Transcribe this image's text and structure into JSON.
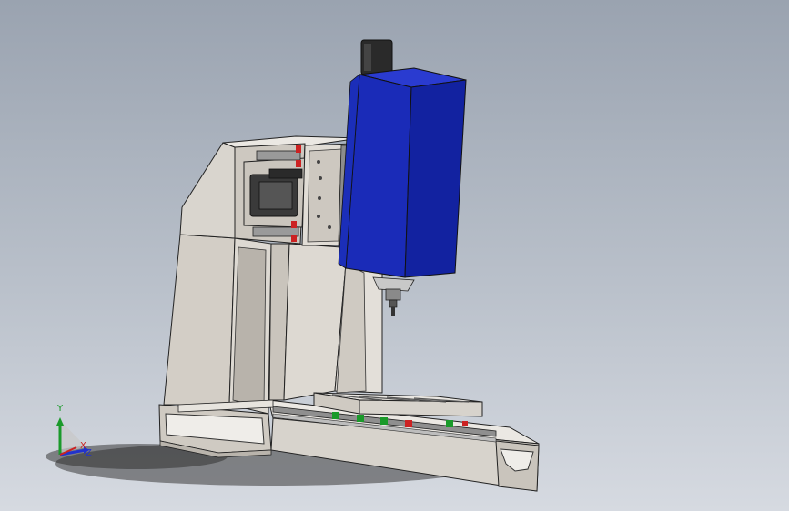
{
  "viewport": {
    "background_top": "#9aa3b0",
    "background_bottom": "#d6dae1"
  },
  "model": {
    "base_color": "#d9d5ce",
    "spindle_color": "#1a2bb8",
    "motor_color": "#2a2a2a",
    "rail_block_colors": [
      "#cc2222",
      "#1a9a2a"
    ]
  },
  "triad": {
    "y_label": "Y",
    "x_label": "X",
    "z_label": "Z",
    "x_color": "#cc2222",
    "y_color": "#1a9a2a",
    "z_color": "#2233cc"
  }
}
